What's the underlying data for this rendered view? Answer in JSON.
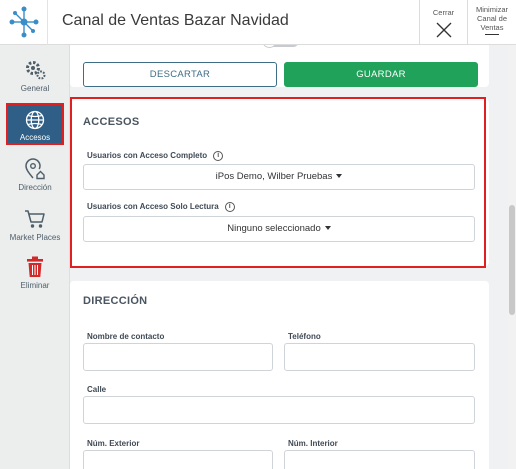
{
  "header": {
    "title": "Canal de Ventas Bazar Navidad",
    "close_label": "Cerrar",
    "minimize_label_1": "Minimizar",
    "minimize_label_2": "Canal de",
    "minimize_label_3": "Ventas"
  },
  "sidebar": {
    "items": [
      {
        "label": "General",
        "icon": "gear-icon"
      },
      {
        "label": "Accesos",
        "icon": "globe-icon"
      },
      {
        "label": "Dirección",
        "icon": "location-icon"
      },
      {
        "label": "Market Places",
        "icon": "cart-icon"
      },
      {
        "label": "Eliminar",
        "icon": "trash-icon"
      }
    ]
  },
  "actions": {
    "discard_label": "DESCARTAR",
    "save_label": "GUARDAR"
  },
  "accesos": {
    "title": "ACCESOS",
    "full_access_label": "Usuarios con Acceso Completo",
    "full_access_value": "iPos Demo, Wilber Pruebas",
    "readonly_label": "Usuarios con Acceso Solo Lectura",
    "readonly_value": "Ninguno seleccionado"
  },
  "direccion": {
    "title": "DIRECCIÓN",
    "contact_label": "Nombre de contacto",
    "phone_label": "Teléfono",
    "street_label": "Calle",
    "ext_label": "Núm. Exterior",
    "int_label": "Núm. Interior"
  },
  "colors": {
    "accent": "#2f5f86",
    "save": "#20a25a",
    "highlight": "#e02020",
    "trash": "#d22a2a"
  }
}
